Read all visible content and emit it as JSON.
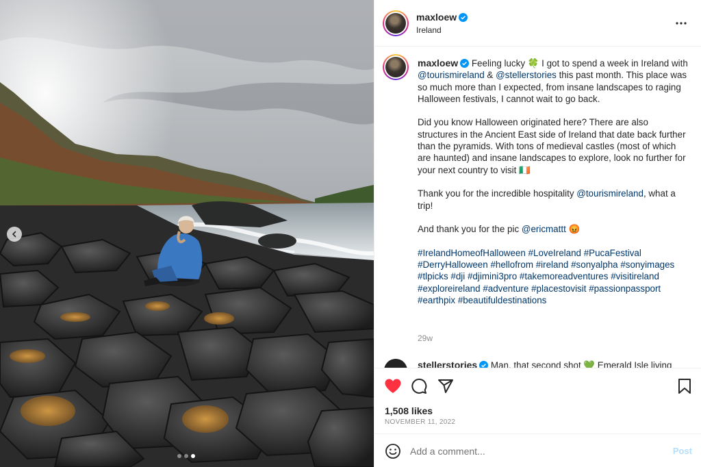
{
  "post": {
    "image_alt": "Woman in blue sweater sitting on basalt columns at the coast",
    "carousel": {
      "dot_count": 3,
      "active_index": 2
    }
  },
  "header": {
    "username": "maxloew",
    "location": "Ireland",
    "more_icon": "more-horizontal-icon"
  },
  "caption": {
    "username": "maxloew",
    "paragraphs": [
      [
        {
          "t": "text",
          "v": "Feeling lucky 🍀 I got to spend a week in Ireland with "
        },
        {
          "t": "mention",
          "v": "@tourismireland"
        },
        {
          "t": "text",
          "v": " & "
        },
        {
          "t": "mention",
          "v": "@stellerstories"
        },
        {
          "t": "text",
          "v": " this past month. This place was so much more than I expected, from insane landscapes to raging Halloween festivals, I cannot wait to go back."
        }
      ],
      [
        {
          "t": "text",
          "v": "Did you know Halloween originated here? There are also structures in the Ancient East side of Ireland that date back further than the pyramids. With tons of medieval castles (most of which are haunted) and insane landscapes to explore, look no further for your next country to visit 🇮🇪"
        }
      ],
      [
        {
          "t": "text",
          "v": "Thank you for the incredible hospitality "
        },
        {
          "t": "mention",
          "v": "@tourismireland"
        },
        {
          "t": "text",
          "v": ", what a trip!"
        }
      ],
      [
        {
          "t": "text",
          "v": "And thank you for the pic "
        },
        {
          "t": "mention",
          "v": "@ericmattt"
        },
        {
          "t": "text",
          "v": " 😡"
        }
      ]
    ],
    "hashtags": [
      "#IrelandHomeofHalloween",
      "#LoveIreland",
      "#PucaFestival",
      "#DerryHalloween",
      "#hellofrom",
      "#ireland",
      "#sonyalpha",
      "#sonyimages",
      "#tlpicks",
      "#dji",
      "#djimini3pro",
      "#takemoreadventures",
      "#visitireland",
      "#exploreireland",
      "#adventure",
      "#placestovisit",
      "#passionpassport",
      "#earthpix",
      "#beautifuldestinations"
    ],
    "time": "29w"
  },
  "comment": {
    "username": "stellerstories",
    "text": "Man, that second shot 💚 Emerald Isle living"
  },
  "actions": {
    "like_icon": "heart-filled-icon",
    "comment_icon": "comment-icon",
    "share_icon": "share-icon",
    "save_icon": "bookmark-icon",
    "likes": "1,508 likes",
    "date": "NOVEMBER 11, 2022"
  },
  "add_comment": {
    "placeholder": "Add a comment...",
    "post_label": "Post",
    "emoji_icon": "emoji-icon"
  },
  "colors": {
    "like_red": "#ff3040",
    "link_blue": "#00376b",
    "verified_blue": "#0095f6",
    "post_disabled": "#b2dffc",
    "secondary_text": "#8e8e8e"
  }
}
